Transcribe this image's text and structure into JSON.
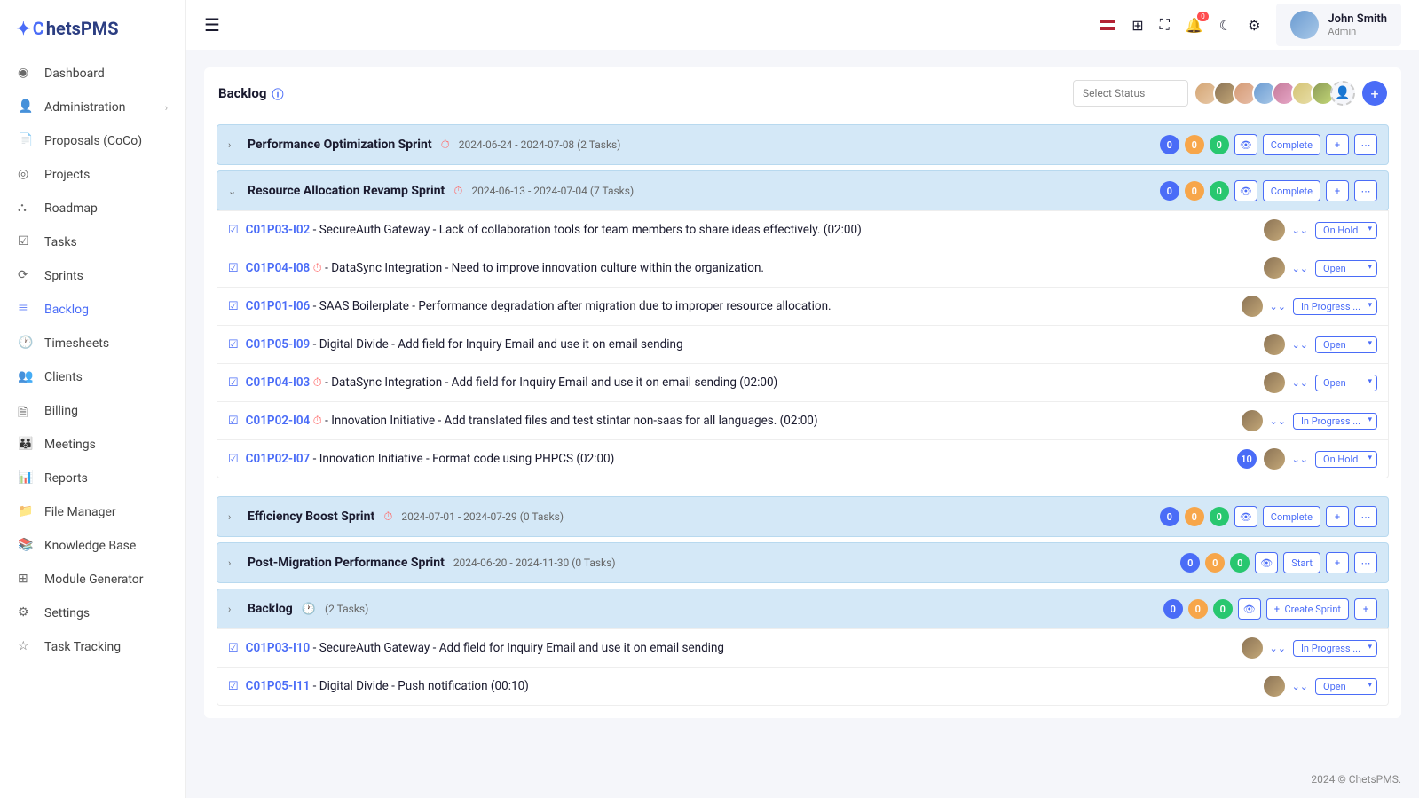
{
  "app": {
    "logo_part1": "C",
    "logo_part2": "hetsPMS"
  },
  "user": {
    "name": "John Smith",
    "role": "Admin"
  },
  "notification_count": "0",
  "sidebar": {
    "items": [
      {
        "label": "Dashboard"
      },
      {
        "label": "Administration",
        "expandable": true
      },
      {
        "label": "Proposals (CoCo)"
      },
      {
        "label": "Projects"
      },
      {
        "label": "Roadmap"
      },
      {
        "label": "Tasks"
      },
      {
        "label": "Sprints"
      },
      {
        "label": "Backlog",
        "active": true
      },
      {
        "label": "Timesheets"
      },
      {
        "label": "Clients"
      },
      {
        "label": "Billing"
      },
      {
        "label": "Meetings"
      },
      {
        "label": "Reports"
      },
      {
        "label": "File Manager"
      },
      {
        "label": "Knowledge Base"
      },
      {
        "label": "Module Generator"
      },
      {
        "label": "Settings"
      },
      {
        "label": "Task Tracking"
      }
    ]
  },
  "page": {
    "title": "Backlog",
    "select_placeholder": "Select Status"
  },
  "sprints": [
    {
      "name": "Performance Optimization Sprint",
      "meta": "2024-06-24 - 2024-07-08 (2 Tasks)",
      "counts": [
        "0",
        "0",
        "0"
      ],
      "action": "Complete",
      "expanded": false,
      "clock": true
    },
    {
      "name": "Resource Allocation Revamp Sprint",
      "meta": "2024-06-13 - 2024-07-04 (7 Tasks)",
      "counts": [
        "0",
        "0",
        "0"
      ],
      "action": "Complete",
      "expanded": true,
      "clock": true,
      "tasks": [
        {
          "code": "C01P03-I02",
          "text": " - SecureAuth Gateway - Lack of collaboration tools for team members to share ideas effectively. (02:00)",
          "status": "On Hold",
          "clock": false
        },
        {
          "code": "C01P04-I08",
          "text": " - DataSync Integration - Need to improve innovation culture within the organization.",
          "status": "Open",
          "clock": true
        },
        {
          "code": "C01P01-I06",
          "text": " - SAAS Boilerplate - Performance degradation after migration due to improper resource allocation.",
          "status": "In Progress ...",
          "clock": false
        },
        {
          "code": "C01P05-I09",
          "text": " - Digital Divide - Add field for Inquiry Email and use it on email sending",
          "status": "Open",
          "clock": false
        },
        {
          "code": "C01P04-I03",
          "text": " - DataSync Integration - Add field for Inquiry Email and use it on email sending (02:00)",
          "status": "Open",
          "clock": true
        },
        {
          "code": "C01P02-I04",
          "text": " - Innovation Initiative - Add translated files and test stintar non-saas for all languages. (02:00)",
          "status": "In Progress ...",
          "clock": true
        },
        {
          "code": "C01P02-I07",
          "text": " - Innovation Initiative - Format code using PHPCS (02:00)",
          "status": "On Hold",
          "clock": false,
          "count": "10"
        }
      ]
    },
    {
      "name": "Efficiency Boost Sprint",
      "meta": "2024-07-01 - 2024-07-29 (0 Tasks)",
      "counts": [
        "0",
        "0",
        "0"
      ],
      "action": "Complete",
      "expanded": false,
      "clock": true
    },
    {
      "name": "Post-Migration Performance Sprint",
      "meta": "2024-06-20 - 2024-11-30 (0 Tasks)",
      "counts": [
        "0",
        "0",
        "0"
      ],
      "action": "Start",
      "expanded": false,
      "clock": false
    }
  ],
  "backlog": {
    "name": "Backlog",
    "meta": "(2 Tasks)",
    "counts": [
      "0",
      "0",
      "0"
    ],
    "action": "Create Sprint",
    "tasks": [
      {
        "code": "C01P03-I10",
        "text": " - SecureAuth Gateway - Add field for Inquiry Email and use it on email sending",
        "status": "In Progress ...",
        "clock": false
      },
      {
        "code": "C01P05-I11",
        "text": " - Digital Divide - Push notification (00:10)",
        "status": "Open",
        "clock": false
      }
    ]
  },
  "footer": "2024 © ChetsPMS."
}
